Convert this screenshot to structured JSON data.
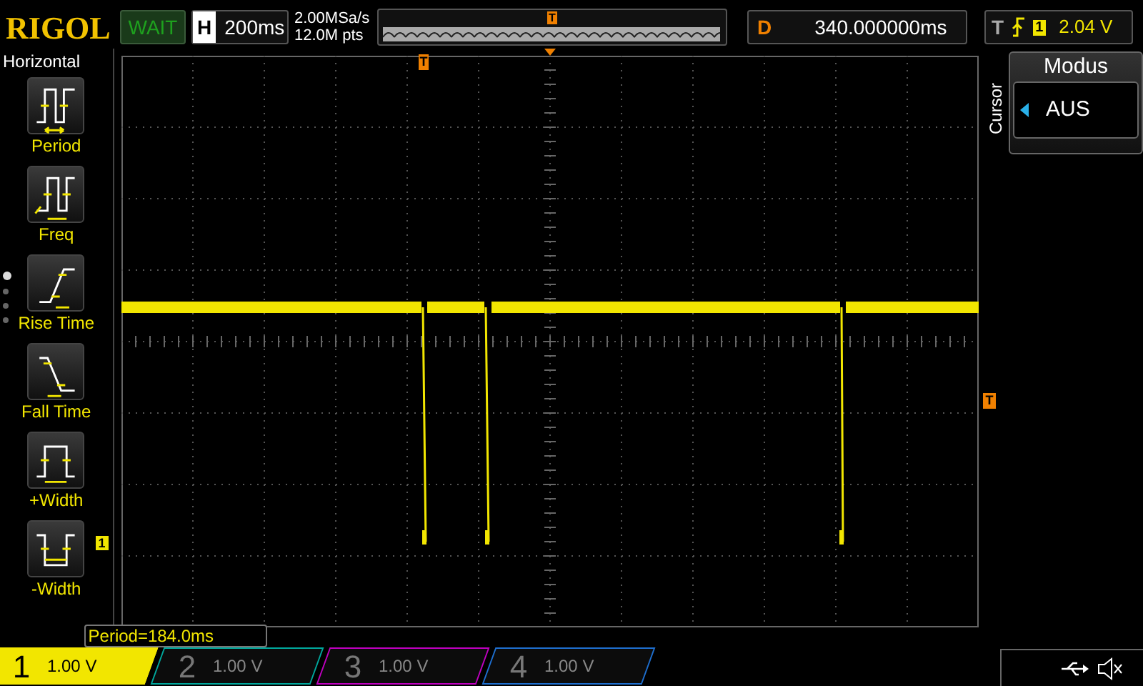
{
  "brand": "RIGOL",
  "run_state": "WAIT",
  "horizontal": {
    "label": "H",
    "timebase": "200ms"
  },
  "acquisition": {
    "sample_rate": "2.00MSa/s",
    "memory_depth": "12.0M pts"
  },
  "trigger_position": {
    "marker": "T"
  },
  "delay": {
    "label": "D",
    "value": "340.000000ms"
  },
  "trigger": {
    "label": "T",
    "source": "1",
    "level": "2.04 V"
  },
  "sidebar": {
    "title": "Horizontal",
    "items": [
      {
        "kind": "period",
        "label": "Period"
      },
      {
        "kind": "freq",
        "label": "Freq"
      },
      {
        "kind": "rise",
        "label": "Rise Time"
      },
      {
        "kind": "fall",
        "label": "Fall Time"
      },
      {
        "kind": "pwidth",
        "label": "+Width"
      },
      {
        "kind": "nwidth",
        "label": "-Width"
      }
    ],
    "pages": [
      {
        "selected": true
      },
      {
        "selected": false
      },
      {
        "selected": false
      },
      {
        "selected": false
      }
    ]
  },
  "graticule": {
    "trigger_marker": "T",
    "level_marker": "T",
    "channel_marker": "1"
  },
  "measurement": "Period=184.0ms",
  "cursor_menu": {
    "side_label": "Cursor",
    "title": "Modus",
    "value": "AUS"
  },
  "channels": [
    {
      "number": "1",
      "scale": "1.00 V",
      "selected": true,
      "color": "#f2e600"
    },
    {
      "number": "2",
      "scale": "1.00 V",
      "selected": false,
      "color": "#00a89d"
    },
    {
      "number": "3",
      "scale": "1.00 V",
      "selected": false,
      "color": "#c000c0"
    },
    {
      "number": "4",
      "scale": "1.00 V",
      "selected": false,
      "color": "#1e6fd0"
    }
  ]
}
